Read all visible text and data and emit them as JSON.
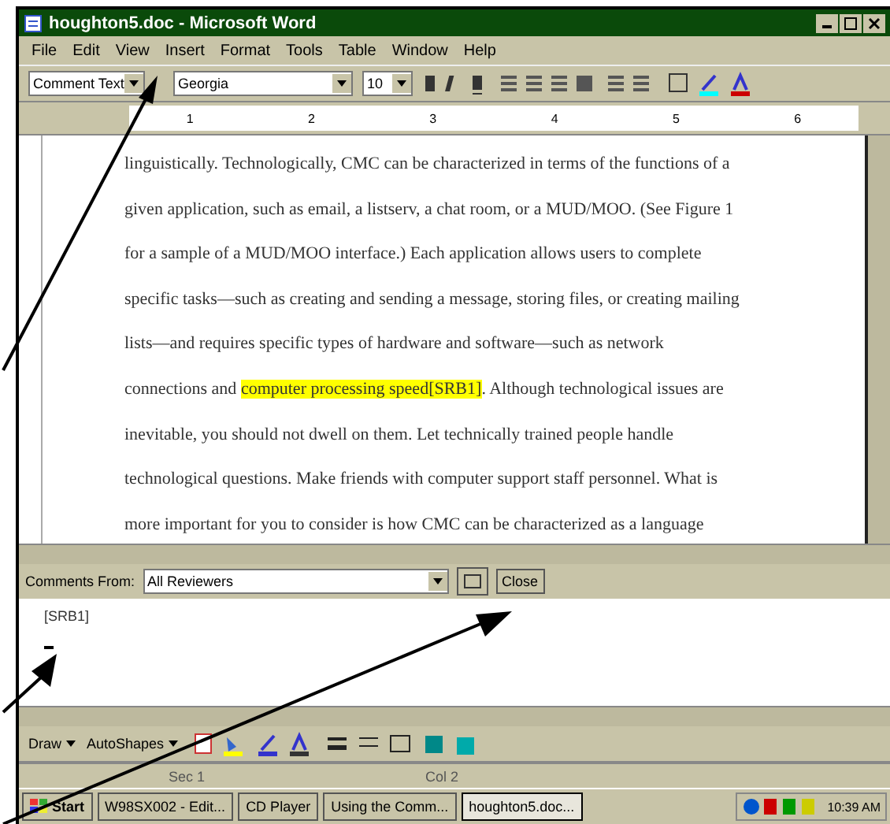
{
  "window": {
    "title": "houghton5.doc - Microsoft Word"
  },
  "menu": [
    "File",
    "Edit",
    "View",
    "Insert",
    "Format",
    "Tools",
    "Table",
    "Window",
    "Help"
  ],
  "formatting_toolbar": {
    "style": "Comment Text",
    "font": "Georgia",
    "size": "10"
  },
  "ruler": [
    "1",
    "2",
    "3",
    "4",
    "5",
    "6"
  ],
  "document": {
    "lines": [
      {
        "parts": [
          {
            "text": "linguistically. Technologically, CMC can be characterized in terms of the functions of a",
            "highlighted": false
          }
        ]
      },
      {
        "parts": [
          {
            "text": "given application, such as email, a listserv, a chat room, or a MUD/MOO. (See Figure 1",
            "highlighted": false
          }
        ]
      },
      {
        "parts": [
          {
            "text": "for a sample of a MUD/MOO interface.) Each application allows users to complete",
            "highlighted": false
          }
        ]
      },
      {
        "parts": [
          {
            "text": "specific tasks—such as creating and sending a message, storing files, or creating mailing",
            "highlighted": false
          }
        ]
      },
      {
        "parts": [
          {
            "text": "lists—and requires specific types of hardware and software—such as network",
            "highlighted": false
          }
        ]
      },
      {
        "parts": [
          {
            "text": "connections and ",
            "highlighted": false
          },
          {
            "text": "computer processing speed[SRB1]",
            "highlighted": true
          },
          {
            "text": ". Although technological issues are",
            "highlighted": false
          }
        ]
      },
      {
        "parts": [
          {
            "text": "inevitable, you should not dwell on them. Let technically trained people handle",
            "highlighted": false
          }
        ]
      },
      {
        "parts": [
          {
            "text": "technological questions. Make friends with computer support staff personnel. What is",
            "highlighted": false
          }
        ]
      },
      {
        "parts": [
          {
            "text": "more important for you to consider is how CMC can be characterized as a language",
            "highlighted": false
          }
        ]
      }
    ]
  },
  "comments_pane": {
    "label": "Comments From:",
    "reviewer": "All Reviewers",
    "close": "Close",
    "comments": [
      "[SRB1]"
    ]
  },
  "drawing_toolbar": {
    "draw": "Draw",
    "autoshapes": "AutoShapes"
  },
  "status_bar": [
    "Sec 1",
    "Col 2"
  ],
  "taskbar": {
    "start": "Start",
    "tasks": [
      {
        "label": "W98SX002 - Edit...",
        "selected": false
      },
      {
        "label": "CD Player",
        "selected": false
      },
      {
        "label": "Using the Comm...",
        "selected": false
      },
      {
        "label": "houghton5.doc...",
        "selected": true
      }
    ],
    "clock": "10:39 AM"
  }
}
